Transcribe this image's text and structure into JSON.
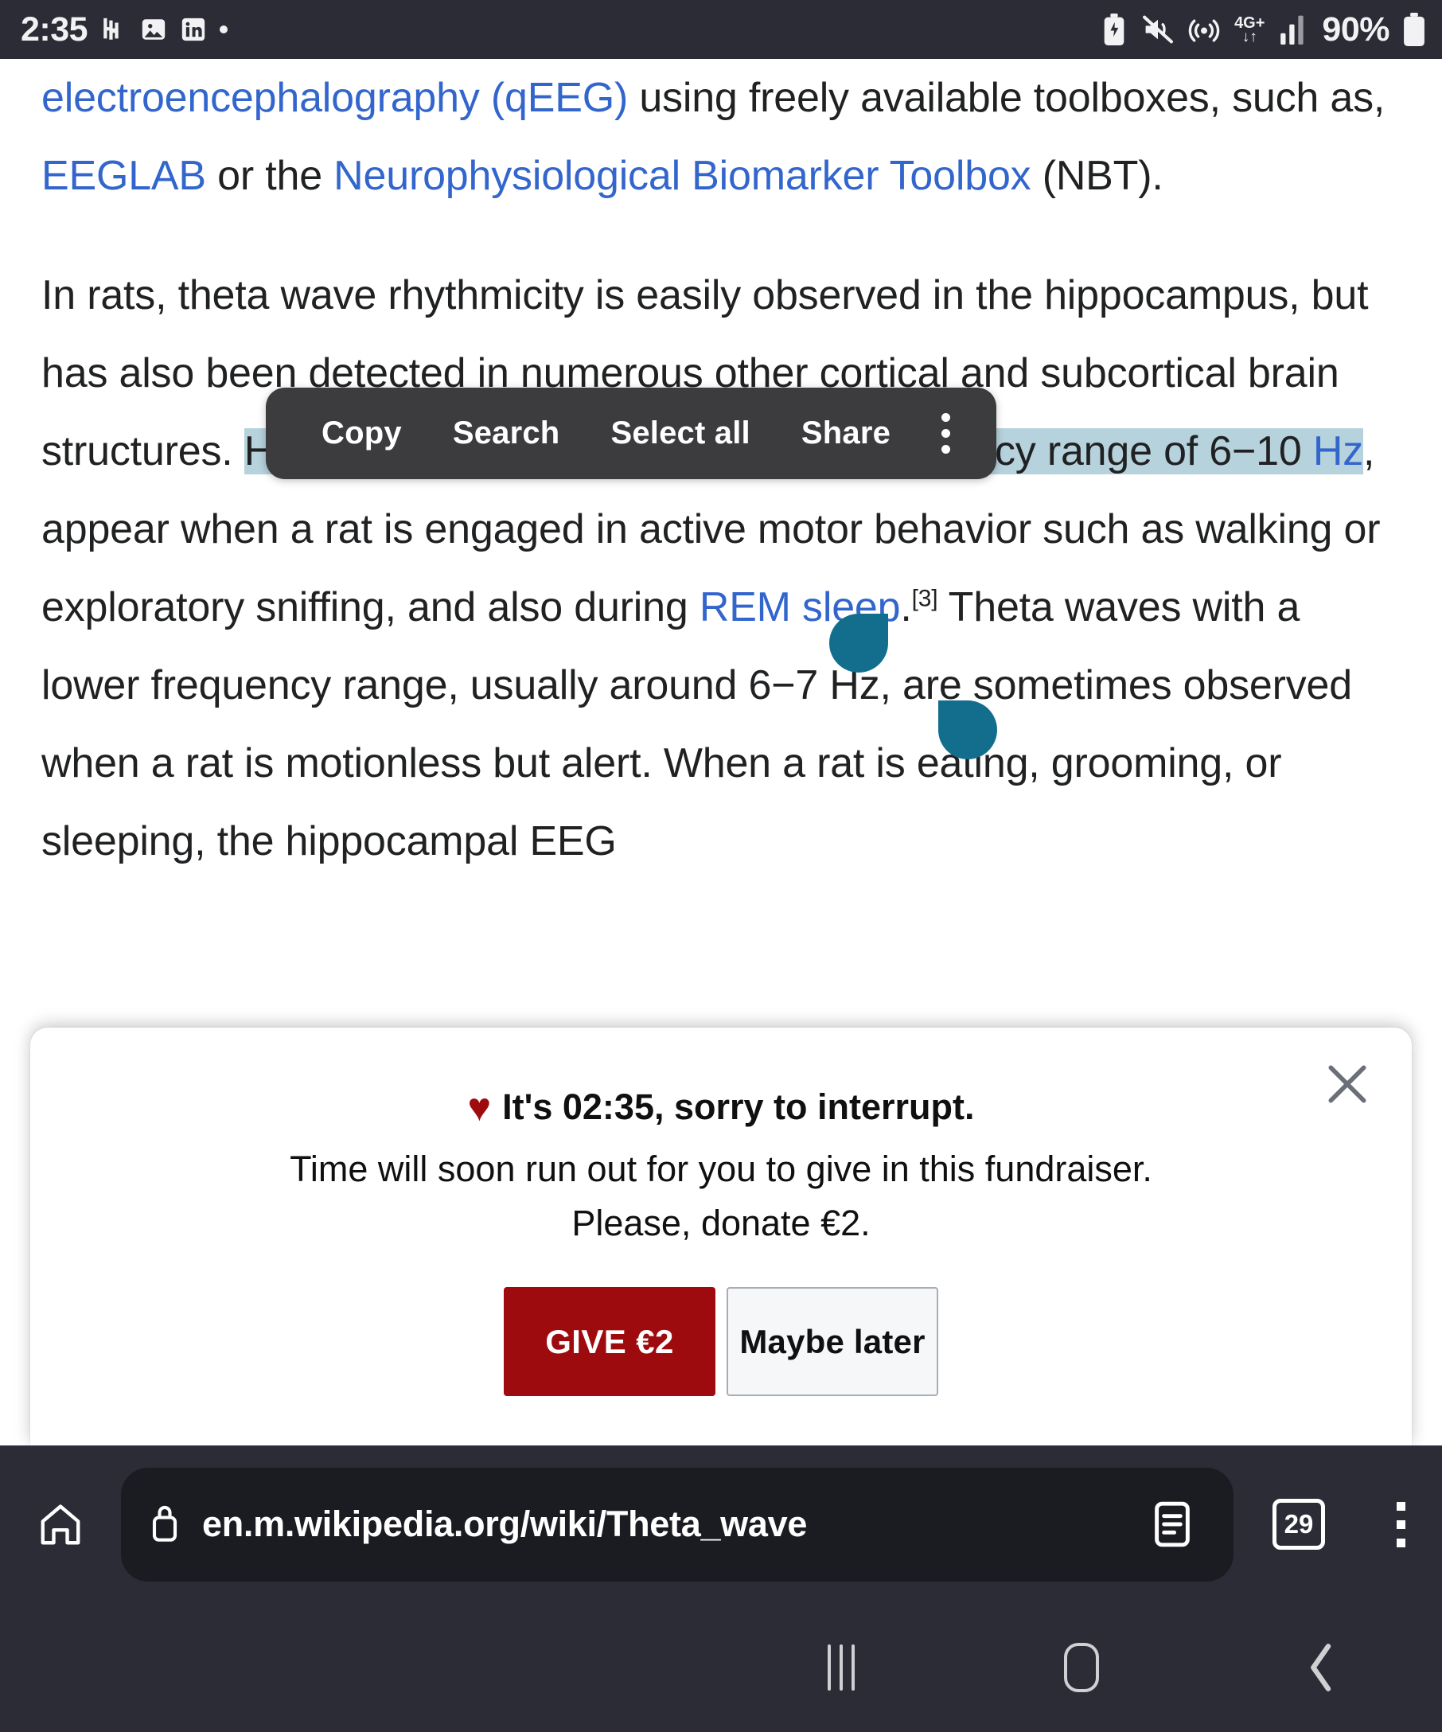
{
  "status_bar": {
    "time": "2:35",
    "icons_left": [
      "hackernews-icon",
      "photo-icon",
      "linkedin-icon",
      "dot-icon"
    ],
    "network_label_top": "4G+",
    "network_label_bottom": "↓↑",
    "battery_percent": "90%",
    "icons_right": [
      "battery-saver-icon",
      "mute-icon",
      "hotspot-icon",
      "network-4gplus-icon",
      "signal-icon",
      "battery-icon"
    ],
    "bg_color": "#2b2c35",
    "fg_color": "#f2f2f4"
  },
  "article": {
    "paragraph_1": {
      "link_1": "electroencephalography (qEEG)",
      "text_1": " using freely available toolboxes, such as, ",
      "link_2": "EEGLAB",
      "text_2": " or the ",
      "link_3": "Neurophysiological Biomarker Toolbox",
      "text_3": " (NBT)."
    },
    "paragraph_2": {
      "text_1": "In rats, theta wave rhythmicity is easily observed in the hippocampus, but has also been detected in numerous other cortical and subcortical brain structures. ",
      "selected_1": "Hippocampal theta waves, with a frequency range of 6−10 ",
      "selected_link": "Hz",
      "text_2": ", appear when a rat is engaged in active motor behavior such as walking or exploratory sniffing, and also during ",
      "link_rem": "REM sleep",
      "text_3": ".",
      "citation": "[3]",
      "text_4": " Theta waves with a lower frequency range, usually around 6−7 Hz, are sometimes observed when a rat is motionless but alert. When a rat is eating, grooming, or sleeping, the hippocampal EEG"
    },
    "link_color": "#3366cc",
    "selection_color": "#b6d2dc",
    "handle_color": "#136d8d"
  },
  "context_menu": {
    "items": [
      "Copy",
      "Search",
      "Select all",
      "Share"
    ],
    "overflow_icon": "kebab-menu-icon",
    "bg_color": "#3c3c3f"
  },
  "banner": {
    "heart_icon": "♥",
    "headline": "It's 02:35, sorry to interrupt.",
    "body_line_1": "Time will soon run out for you to give in this fundraiser.",
    "body_line_2": "Please, donate €2.",
    "give_label": "GIVE €2",
    "later_label": "Maybe later",
    "close_icon": "close-icon",
    "give_color": "#9e0b0f"
  },
  "browser_bar": {
    "home_icon": "home-icon",
    "lock_icon": "lock-icon",
    "url": "en.m.wikipedia.org/wiki/Theta_wave",
    "reader_icon": "reader-mode-icon",
    "tab_count": "29",
    "more_icon": "kebab-menu-icon",
    "bg_color": "#2b2c35"
  },
  "nav_bar": {
    "recents_label": "recents-icon",
    "home_label": "home-icon",
    "back_label": "back-icon"
  }
}
